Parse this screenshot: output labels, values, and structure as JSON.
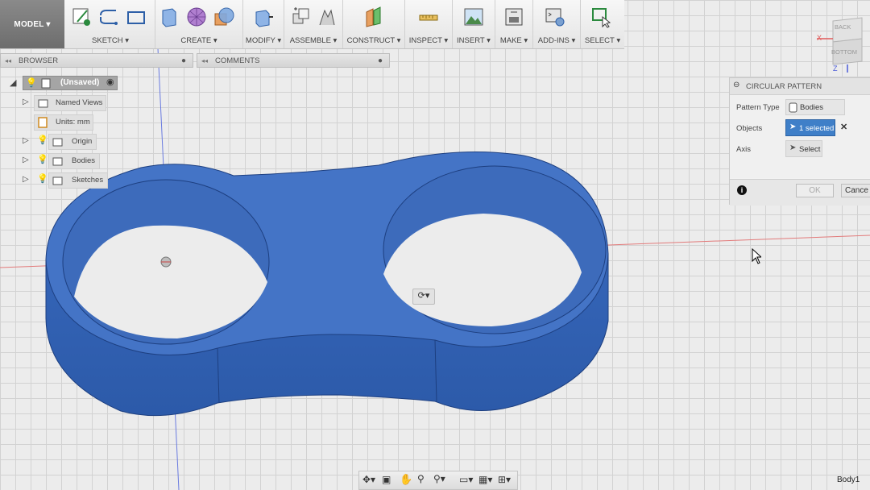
{
  "toolbar": {
    "model_label": "MODEL ▾",
    "groups": [
      {
        "label": "SKETCH ▾"
      },
      {
        "label": "CREATE ▾"
      },
      {
        "label": "MODIFY ▾"
      },
      {
        "label": "ASSEMBLE ▾"
      },
      {
        "label": "CONSTRUCT ▾"
      },
      {
        "label": "INSPECT ▾"
      },
      {
        "label": "INSERT ▾"
      },
      {
        "label": "MAKE ▾"
      },
      {
        "label": "ADD-INS ▾"
      },
      {
        "label": "SELECT ▾"
      }
    ]
  },
  "browser": {
    "title": "BROWSER",
    "root": "(Unsaved)",
    "items": [
      {
        "label": "Named Views"
      },
      {
        "label": "Units: mm"
      },
      {
        "label": "Origin"
      },
      {
        "label": "Bodies"
      },
      {
        "label": "Sketches"
      }
    ]
  },
  "comments": {
    "title": "COMMENTS"
  },
  "viewcube": {
    "back": "BACK",
    "bottom": "BOTTOM",
    "x_axis": "X",
    "z_axis": "Z"
  },
  "dialog": {
    "title": "CIRCULAR PATTERN",
    "pattern_type_label": "Pattern Type",
    "pattern_type_value": "Bodies",
    "objects_label": "Objects",
    "objects_value": "1 selected",
    "clear_symbol": "✕",
    "axis_label": "Axis",
    "axis_value": "Select",
    "ok": "OK",
    "cancel": "Cance"
  },
  "status": {
    "body_label": "Body1"
  },
  "colors": {
    "body_blue": "#3f6fc3",
    "accent_blue": "#3f7fc8",
    "axis_red": "#e05a5a",
    "axis_blue": "#4a5bd8"
  }
}
